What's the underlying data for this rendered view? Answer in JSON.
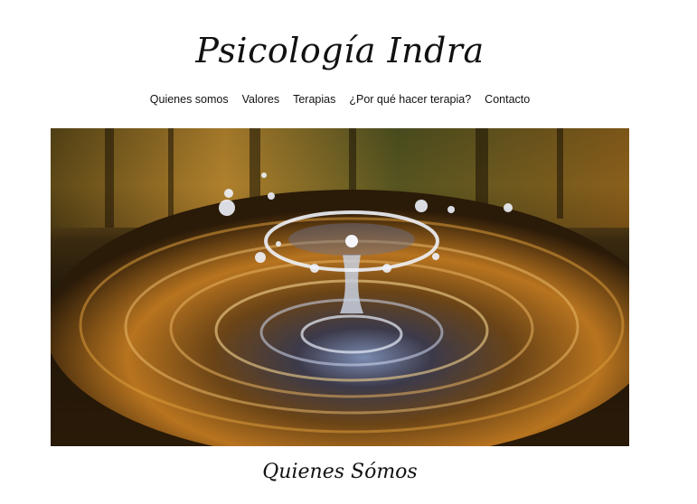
{
  "site": {
    "title": "Psicología Indra"
  },
  "nav": {
    "items": [
      {
        "label": "Quienes somos"
      },
      {
        "label": "Valores"
      },
      {
        "label": "Terapias"
      },
      {
        "label": "¿Por qué hacer terapia?"
      },
      {
        "label": "Contacto"
      }
    ]
  },
  "hero": {
    "image": "water-drop-splash-photo",
    "colors": {
      "dark": "#2a1a08",
      "amber": "#b8741f",
      "gold": "#e0a94a",
      "forest": "#3f4a1f"
    }
  },
  "main": {
    "section_title": "Quienes Sómos"
  }
}
